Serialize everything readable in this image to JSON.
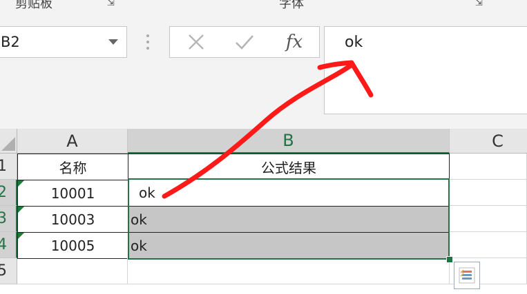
{
  "ribbon": {
    "clipboard_label": "剪贴板",
    "font_label": "字体"
  },
  "formula_bar": {
    "name_box": "B2",
    "cancel_icon": "x-icon",
    "enter_icon": "check-icon",
    "function_label": "fx",
    "value": "ok"
  },
  "columns": [
    "A",
    "B",
    "C"
  ],
  "rows": [
    "1",
    "2",
    "3",
    "4",
    "5"
  ],
  "cells": {
    "A1": "名称",
    "B1": "公式结果",
    "A2": "10001",
    "B2": "ok",
    "A3": "10003",
    "B3": "ok",
    "A4": "10005",
    "B4": "ok"
  },
  "selection": "B2:B4",
  "colors": {
    "accent_green": "#217346",
    "annotation_red": "#ff1a1a",
    "selection_fill": "#c6c6c6"
  }
}
